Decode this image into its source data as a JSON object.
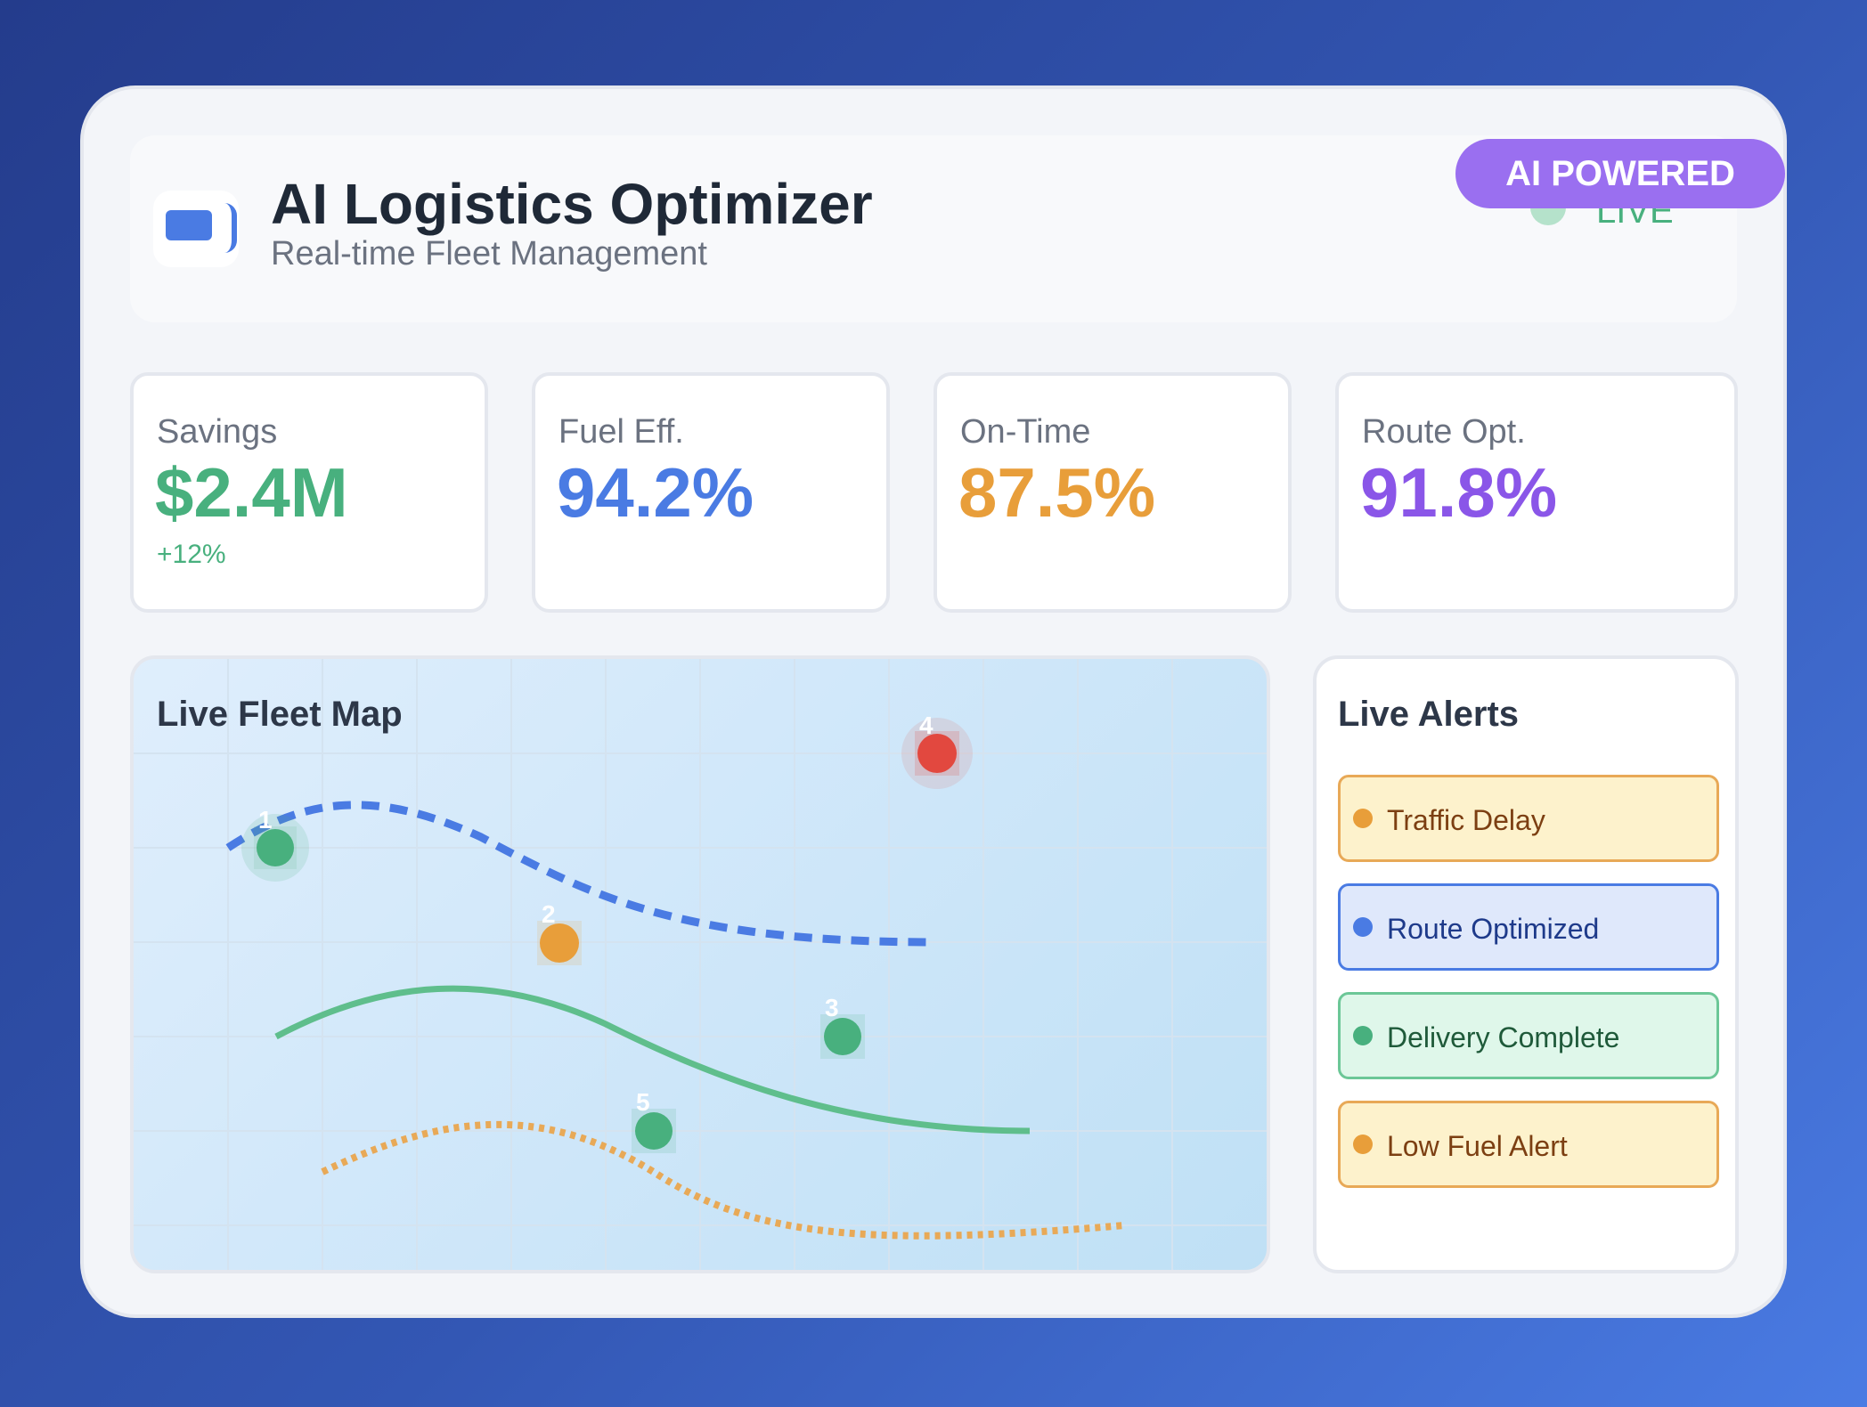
{
  "header": {
    "title": "AI Logistics Optimizer",
    "subtitle": "Real-time Fleet Management",
    "badge": "AI POWERED",
    "status": "LIVE"
  },
  "metrics": [
    {
      "label": "Savings",
      "value": "$2.4M",
      "delta": "+12%",
      "color": "#48b07e"
    },
    {
      "label": "Fuel Eff.",
      "value": "94.2%",
      "color": "#4a7be3"
    },
    {
      "label": "On-Time",
      "value": "87.5%",
      "color": "#e89e3a"
    },
    {
      "label": "Route Opt.",
      "value": "91.8%",
      "color": "#8a56e8"
    }
  ],
  "map": {
    "title": "Live Fleet Map",
    "vehicles": [
      {
        "id": "1",
        "status": "active",
        "color": "#48b07e"
      },
      {
        "id": "2",
        "status": "warning",
        "color": "#e89e3a"
      },
      {
        "id": "3",
        "status": "active",
        "color": "#48b07e"
      },
      {
        "id": "4",
        "status": "critical",
        "color": "#e2483f"
      },
      {
        "id": "5",
        "status": "active",
        "color": "#48b07e"
      }
    ],
    "routes": [
      {
        "style": "dashed",
        "color": "#4a7be3"
      },
      {
        "style": "solid",
        "color": "#5fbe8c"
      },
      {
        "style": "dotted",
        "color": "#e8a957"
      }
    ]
  },
  "alerts": {
    "title": "Live Alerts",
    "items": [
      {
        "text": "Traffic Delay",
        "icon": "warning-dot",
        "bg": "#fdf2cc",
        "border": "#e8a957",
        "dot": "#e89e3a",
        "color": "#7c3f12"
      },
      {
        "text": "Route Optimized",
        "icon": "info-dot",
        "bg": "#dfe8fb",
        "border": "#4a7be3",
        "dot": "#4a7be3",
        "color": "#1e3a8a"
      },
      {
        "text": "Delivery Complete",
        "icon": "success-dot",
        "bg": "#dff7ea",
        "border": "#6cc797",
        "dot": "#48b07e",
        "color": "#1f5a3a"
      },
      {
        "text": "Low Fuel Alert",
        "icon": "warning-dot",
        "bg": "#fdf2cc",
        "border": "#e8a957",
        "dot": "#e89e3a",
        "color": "#7c3f12"
      }
    ]
  }
}
